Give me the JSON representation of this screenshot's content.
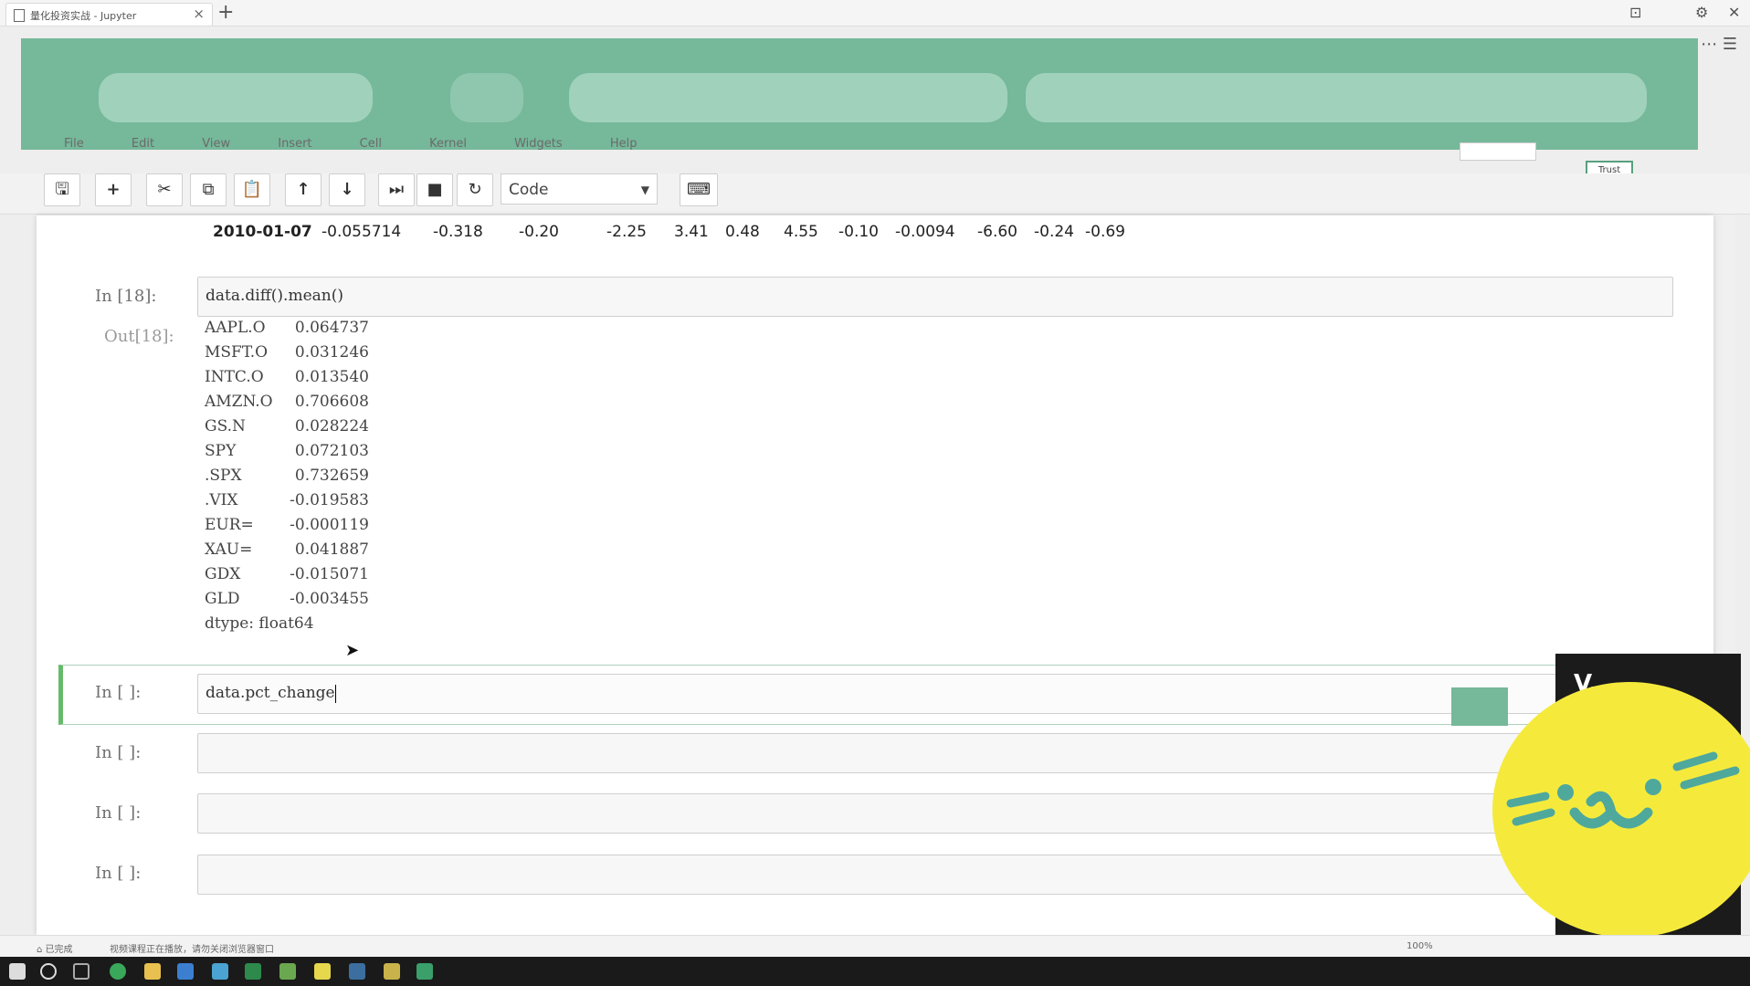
{
  "browser": {
    "tab_title": "量化投资实战 - Jupyter",
    "tab_close": "×",
    "new_tab": "+",
    "window_controls": [
      "⊡",
      "⚙",
      "✕"
    ],
    "addr_buttons": "⋯ ☰"
  },
  "notebook": {
    "menu": [
      "File",
      "Edit",
      "View",
      "Insert",
      "Cell",
      "Kernel",
      "Widgets",
      "Help"
    ],
    "trusted_label": "Trust"
  },
  "toolbar": {
    "buttons": [
      {
        "name": "save",
        "glyph": "🖫"
      },
      {
        "name": "insert-cell",
        "glyph": "+"
      },
      {
        "name": "cut",
        "glyph": "✂"
      },
      {
        "name": "copy",
        "glyph": "⧉"
      },
      {
        "name": "paste",
        "glyph": "📋"
      },
      {
        "name": "move-up",
        "glyph": "↑"
      },
      {
        "name": "move-down",
        "glyph": "↓"
      },
      {
        "name": "run",
        "glyph": "⏭"
      },
      {
        "name": "interrupt",
        "glyph": "■"
      },
      {
        "name": "restart",
        "glyph": "↻"
      },
      {
        "name": "keyboard",
        "glyph": "⌨"
      }
    ],
    "cell_type": "Code",
    "cell_type_arrow": "▼"
  },
  "dataframe_row": {
    "index": "2010-01-07",
    "values": [
      "-0.055714",
      "-0.318",
      "-0.20",
      "-2.25",
      "3.41",
      "0.48",
      "4.55",
      "-0.10",
      "-0.0094",
      "-6.60",
      "-0.24",
      "-0.69"
    ]
  },
  "cells": [
    {
      "prompt_in": "In [18]:",
      "code": "data.diff().mean()"
    },
    {
      "prompt_in": "In [ ]:",
      "code": "data.pct_change"
    },
    {
      "prompt_in": "In [ ]:",
      "code": ""
    },
    {
      "prompt_in": "In [ ]:",
      "code": ""
    },
    {
      "prompt_in": "In [ ]:",
      "code": ""
    }
  ],
  "output": {
    "prompt_out": "Out[18]:",
    "series": [
      {
        "key": "AAPL.O",
        "value": "0.064737"
      },
      {
        "key": "MSFT.O",
        "value": "0.031246"
      },
      {
        "key": "INTC.O",
        "value": "0.013540"
      },
      {
        "key": "AMZN.O",
        "value": "0.706608"
      },
      {
        "key": "GS.N",
        "value": "0.028224"
      },
      {
        "key": "SPY",
        "value": "0.072103"
      },
      {
        "key": ".SPX",
        "value": "0.732659"
      },
      {
        "key": ".VIX",
        "value": "-0.019583"
      },
      {
        "key": "EUR=",
        "value": "-0.000119"
      },
      {
        "key": "XAU=",
        "value": "0.041887"
      },
      {
        "key": "GDX",
        "value": "-0.015071"
      },
      {
        "key": "GLD",
        "value": "-0.003455"
      }
    ],
    "dtype": "dtype: float64"
  },
  "overlay": {
    "dark_panel_text": "V..."
  },
  "statusbar": {
    "left": "⌂ 已完成",
    "middle": "视频课程正在播放，请勿关闭浏览器窗口",
    "right": "100%"
  },
  "colors": {
    "banner": "#76b89a",
    "sticker": "#f5ea3c",
    "sticker_face": "#4fa89c"
  }
}
